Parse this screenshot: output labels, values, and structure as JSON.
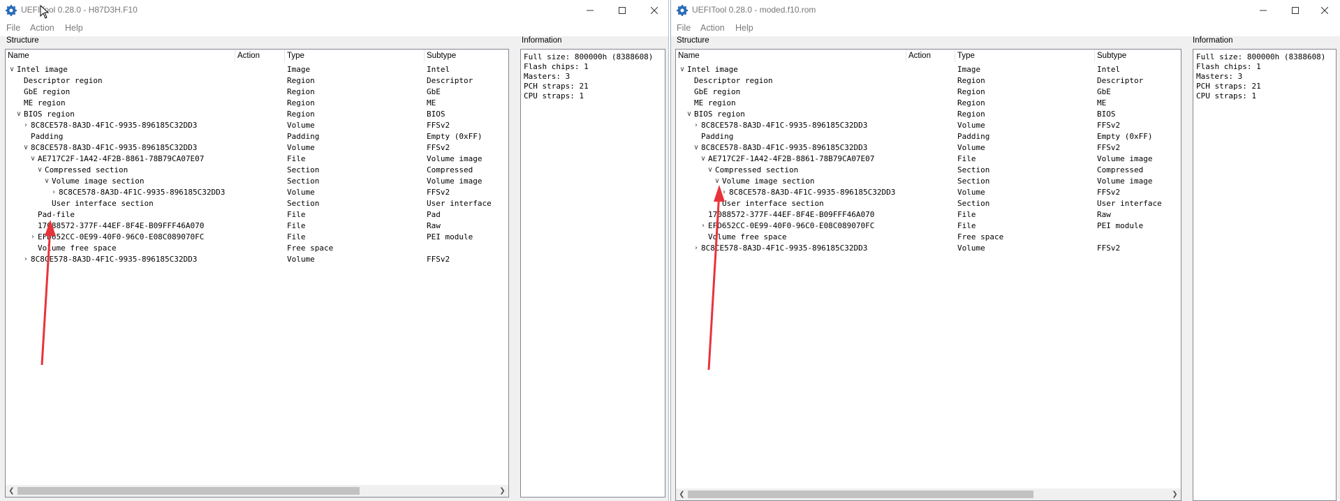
{
  "menu": [
    "File",
    "Action",
    "Help"
  ],
  "structure_label": "Structure",
  "info_label": "Information",
  "columns": [
    "Name",
    "Action",
    "Type",
    "Subtype"
  ],
  "left": {
    "title": "UEFITool 0.28.0 - H87D3H.F10",
    "rows": [
      {
        "name": "Intel image",
        "type": "Image",
        "subtype": "Intel",
        "level": 0,
        "exp": "v"
      },
      {
        "name": "Descriptor region",
        "type": "Region",
        "subtype": "Descriptor",
        "level": 1,
        "exp": ""
      },
      {
        "name": "GbE region",
        "type": "Region",
        "subtype": "GbE",
        "level": 1,
        "exp": ""
      },
      {
        "name": "ME region",
        "type": "Region",
        "subtype": "ME",
        "level": 1,
        "exp": ""
      },
      {
        "name": "BIOS region",
        "type": "Region",
        "subtype": "BIOS",
        "level": 1,
        "exp": "v"
      },
      {
        "name": "8C8CE578-8A3D-4F1C-9935-896185C32DD3",
        "type": "Volume",
        "subtype": "FFSv2",
        "level": 2,
        "exp": ">"
      },
      {
        "name": "Padding",
        "type": "Padding",
        "subtype": "Empty (0xFF)",
        "level": 2,
        "exp": ""
      },
      {
        "name": "8C8CE578-8A3D-4F1C-9935-896185C32DD3",
        "type": "Volume",
        "subtype": "FFSv2",
        "level": 2,
        "exp": "v"
      },
      {
        "name": "AE717C2F-1A42-4F2B-8861-78B79CA07E07",
        "type": "File",
        "subtype": "Volume image",
        "level": 3,
        "exp": "v"
      },
      {
        "name": "Compressed section",
        "type": "Section",
        "subtype": "Compressed",
        "level": 4,
        "exp": "v"
      },
      {
        "name": "Volume image section",
        "type": "Section",
        "subtype": "Volume image",
        "level": 5,
        "exp": "v"
      },
      {
        "name": "8C8CE578-8A3D-4F1C-9935-896185C32DD3",
        "type": "Volume",
        "subtype": "FFSv2",
        "level": 6,
        "exp": ">"
      },
      {
        "name": "User interface section",
        "type": "Section",
        "subtype": "User interface",
        "level": 5,
        "exp": ""
      },
      {
        "name": "Pad-file",
        "type": "File",
        "subtype": "Pad",
        "level": 3,
        "exp": ""
      },
      {
        "name": "17088572-377F-44EF-8F4E-B09FFF46A070",
        "type": "File",
        "subtype": "Raw",
        "level": 3,
        "exp": ""
      },
      {
        "name": "EFD652CC-0E99-40F0-96C0-E08C089070FC",
        "type": "File",
        "subtype": "PEI module",
        "level": 3,
        "exp": ">"
      },
      {
        "name": "Volume free space",
        "type": "Free space",
        "subtype": "",
        "level": 3,
        "exp": ""
      },
      {
        "name": "8C8CE578-8A3D-4F1C-9935-896185C32DD3",
        "type": "Volume",
        "subtype": "FFSv2",
        "level": 2,
        "exp": ">"
      }
    ],
    "info": "Full size: 800000h (8388608)\nFlash chips: 1\nMasters: 3\nPCH straps: 21\nCPU straps: 1"
  },
  "right": {
    "title": "UEFITool 0.28.0 - moded.f10.rom",
    "rows": [
      {
        "name": "Intel image",
        "type": "Image",
        "subtype": "Intel",
        "level": 0,
        "exp": "v"
      },
      {
        "name": "Descriptor region",
        "type": "Region",
        "subtype": "Descriptor",
        "level": 1,
        "exp": ""
      },
      {
        "name": "GbE region",
        "type": "Region",
        "subtype": "GbE",
        "level": 1,
        "exp": ""
      },
      {
        "name": "ME region",
        "type": "Region",
        "subtype": "ME",
        "level": 1,
        "exp": ""
      },
      {
        "name": "BIOS region",
        "type": "Region",
        "subtype": "BIOS",
        "level": 1,
        "exp": "v"
      },
      {
        "name": "8C8CE578-8A3D-4F1C-9935-896185C32DD3",
        "type": "Volume",
        "subtype": "FFSv2",
        "level": 2,
        "exp": ">"
      },
      {
        "name": "Padding",
        "type": "Padding",
        "subtype": "Empty (0xFF)",
        "level": 2,
        "exp": ""
      },
      {
        "name": "8C8CE578-8A3D-4F1C-9935-896185C32DD3",
        "type": "Volume",
        "subtype": "FFSv2",
        "level": 2,
        "exp": "v"
      },
      {
        "name": "AE717C2F-1A42-4F2B-8861-78B79CA07E07",
        "type": "File",
        "subtype": "Volume image",
        "level": 3,
        "exp": "v"
      },
      {
        "name": "Compressed section",
        "type": "Section",
        "subtype": "Compressed",
        "level": 4,
        "exp": "v"
      },
      {
        "name": "Volume image section",
        "type": "Section",
        "subtype": "Volume image",
        "level": 5,
        "exp": "v"
      },
      {
        "name": "8C8CE578-8A3D-4F1C-9935-896185C32DD3",
        "type": "Volume",
        "subtype": "FFSv2",
        "level": 6,
        "exp": ">"
      },
      {
        "name": "User interface section",
        "type": "Section",
        "subtype": "User interface",
        "level": 5,
        "exp": ""
      },
      {
        "name": "17088572-377F-44EF-8F4E-B09FFF46A070",
        "type": "File",
        "subtype": "Raw",
        "level": 3,
        "exp": ""
      },
      {
        "name": "EFD652CC-0E99-40F0-96C0-E08C089070FC",
        "type": "File",
        "subtype": "PEI module",
        "level": 3,
        "exp": ">"
      },
      {
        "name": "Volume free space",
        "type": "Free space",
        "subtype": "",
        "level": 3,
        "exp": ""
      },
      {
        "name": "8C8CE578-8A3D-4F1C-9935-896185C32DD3",
        "type": "Volume",
        "subtype": "FFSv2",
        "level": 2,
        "exp": ">"
      }
    ],
    "info": "Full size: 800000h (8388608)\nFlash chips: 1\nMasters: 3\nPCH straps: 21\nCPU straps: 1"
  },
  "colors": {
    "annotation_arrow": "#e8333a",
    "icon_blue": "#2b6cb8"
  }
}
